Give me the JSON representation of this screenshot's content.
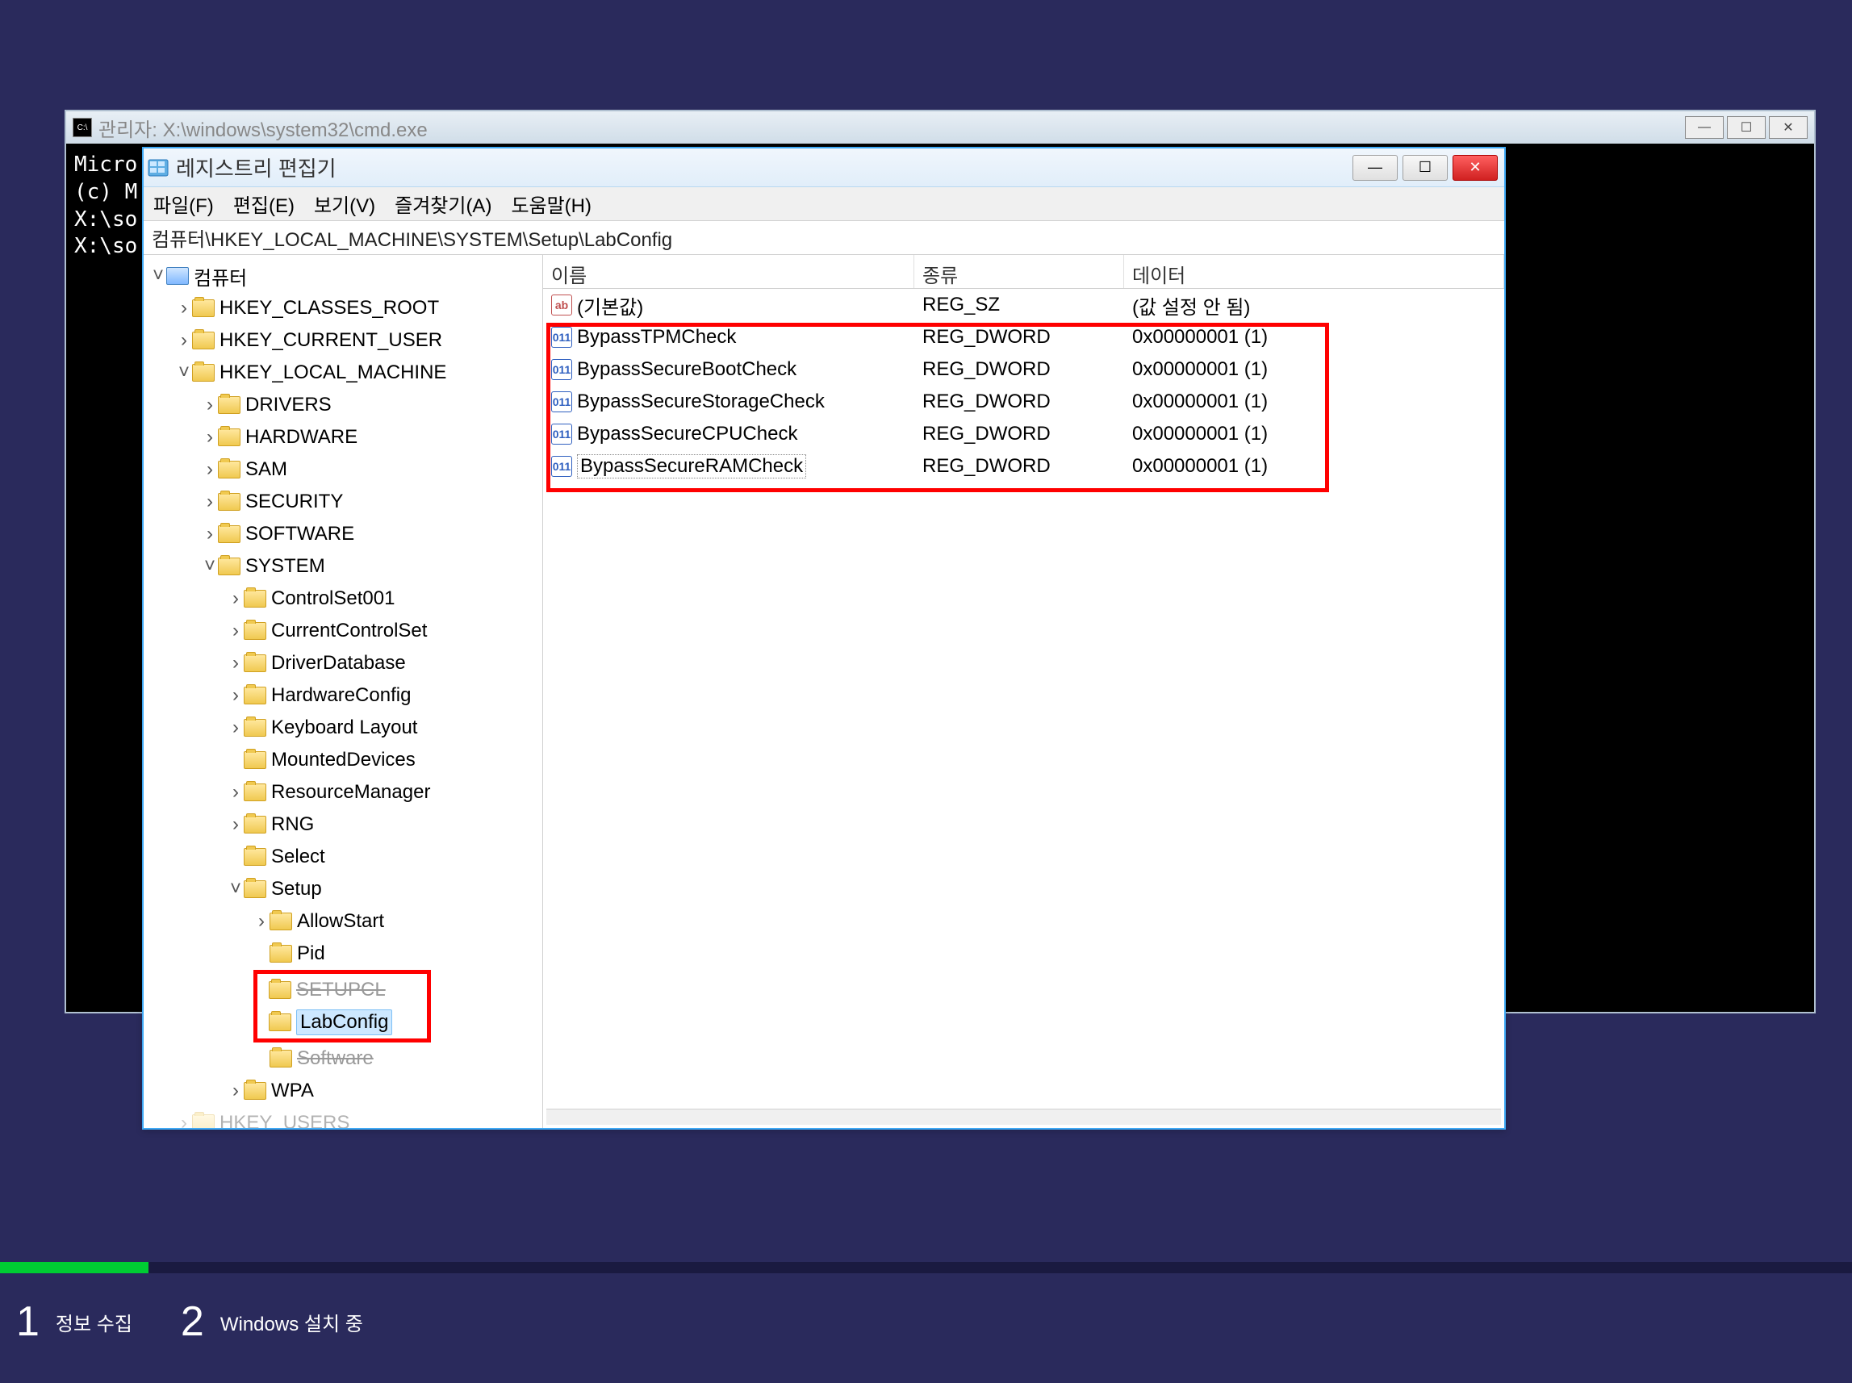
{
  "cmd": {
    "title": "관리자: X:\\windows\\system32\\cmd.exe",
    "lines": [
      "Micro",
      "(c) M",
      "",
      "X:\\so",
      "",
      "X:\\so"
    ]
  },
  "regedit": {
    "title": "레지스트리 편집기",
    "menu": {
      "file": "파일(F)",
      "edit": "편집(E)",
      "view": "보기(V)",
      "favorites": "즐겨찾기(A)",
      "help": "도움말(H)"
    },
    "path": "컴퓨터\\HKEY_LOCAL_MACHINE\\SYSTEM\\Setup\\LabConfig",
    "tree": {
      "root": "컴퓨터",
      "hkcr": "HKEY_CLASSES_ROOT",
      "hkcu": "HKEY_CURRENT_USER",
      "hklm": "HKEY_LOCAL_MACHINE",
      "drivers": "DRIVERS",
      "hardware": "HARDWARE",
      "sam": "SAM",
      "security": "SECURITY",
      "software": "SOFTWARE",
      "system": "SYSTEM",
      "controlset001": "ControlSet001",
      "currentcontrolset": "CurrentControlSet",
      "driverdatabase": "DriverDatabase",
      "hardwareconfig": "HardwareConfig",
      "keyboardlayout": "Keyboard Layout",
      "mounteddevices": "MountedDevices",
      "resourcemanager": "ResourceManager",
      "rng": "RNG",
      "select": "Select",
      "setup": "Setup",
      "allowstart": "AllowStart",
      "pid": "Pid",
      "setupcl": "SETUPCL",
      "labconfig": "LabConfig",
      "software2": "Software",
      "wpa": "WPA",
      "hku": "HKEY_USERS"
    },
    "list": {
      "headers": {
        "name": "이름",
        "type": "종류",
        "data": "데이터"
      },
      "rows": [
        {
          "icon": "sz",
          "name": "(기본값)",
          "type": "REG_SZ",
          "data": "(값 설정 안 됨)"
        },
        {
          "icon": "dword",
          "name": "BypassTPMCheck",
          "type": "REG_DWORD",
          "data": "0x00000001 (1)"
        },
        {
          "icon": "dword",
          "name": "BypassSecureBootCheck",
          "type": "REG_DWORD",
          "data": "0x00000001 (1)"
        },
        {
          "icon": "dword",
          "name": "BypassSecureStorageCheck",
          "type": "REG_DWORD",
          "data": "0x00000001 (1)"
        },
        {
          "icon": "dword",
          "name": "BypassSecureCPUCheck",
          "type": "REG_DWORD",
          "data": "0x00000001 (1)"
        },
        {
          "icon": "dword",
          "name": "BypassSecureRAMCheck",
          "type": "REG_DWORD",
          "data": "0x00000001 (1)"
        }
      ]
    }
  },
  "setup": {
    "step1_num": "1",
    "step1_label": "정보 수집",
    "step2_num": "2",
    "step2_label": "Windows 설치 중"
  }
}
